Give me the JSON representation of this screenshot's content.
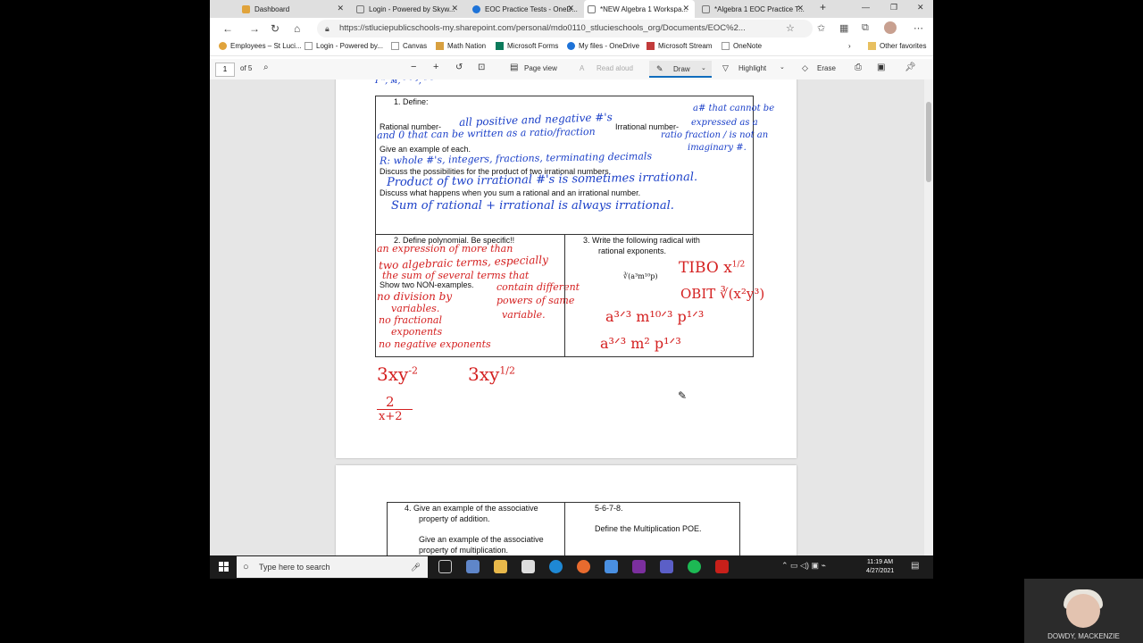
{
  "browser": {
    "tabs": [
      {
        "label": "Dashboard"
      },
      {
        "label": "Login - Powered by Skyw..."
      },
      {
        "label": "EOC Practice Tests - OneD..."
      },
      {
        "label": "*NEW Algebra 1 Workspa..."
      },
      {
        "label": "*Algebra 1 EOC Practice T..."
      }
    ],
    "url": "https://stluciepublicschools-my.sharepoint.com/personal/mdo0110_stlucieschools_org/Documents/EOC%2...",
    "favorites": [
      "Employees – St Luci...",
      "Login - Powered by...",
      "Canvas",
      "Math Nation",
      "Microsoft Forms",
      "My files - OneDrive",
      "Microsoft Stream",
      "OneNote"
    ],
    "other_favorites": "Other favorites"
  },
  "pdf_toolbar": {
    "page_number": "1",
    "page_total": "of 5",
    "page_view": "Page view",
    "read_aloud": "Read aloud",
    "draw": "Draw",
    "highlight": "Highlight",
    "erase": "Erase"
  },
  "page1": {
    "q1_title": "1.   Define:",
    "rational_label": "Rational number-",
    "irrational_label": "Irrational number-",
    "give_example": "Give an example of each.",
    "discuss_product": "Discuss the possibilities for the product of two irrational numbers.",
    "discuss_sum": "Discuss what happens when you sum a rational and an irrational number.",
    "q2_title": "2.   Define polynomial.  Be specific!!",
    "show_non": "Show two NON-examples.",
    "q3_line1": "3.   Write the following radical with",
    "q3_line2": "rational exponents.",
    "radical_expr": "∛(a³m¹⁰p)",
    "hw_rational_1": "all positive and negative #'s",
    "hw_rational_2": "and 0 that can be written as a ratio/fraction",
    "hw_irrational_1": "a# that cannot be",
    "hw_irrational_2": "expressed as a",
    "hw_irrational_3": "ratio fraction / is not an",
    "hw_irrational_4": "imaginary #.",
    "hw_example": "R: whole #'s, integers, fractions, terminating decimals",
    "hw_product": "Product of two irrational #'s is sometimes irrational.",
    "hw_sum": "Sum of rational + irrational is always irrational.",
    "hw_poly_1": "an expression of more than",
    "hw_poly_2": "two algebraic terms, especially",
    "hw_poly_3": "the sum of several terms that",
    "hw_poly_4": "contain different",
    "hw_poly_5": "powers of same",
    "hw_poly_6": "variable.",
    "hw_non_1": "no division by",
    "hw_non_2": "variables.",
    "hw_non_3": "no fractional",
    "hw_non_4": "exponents",
    "hw_non_5": "no negative exponents",
    "hw_tibo": "TIBO  x",
    "hw_tibo_exp": "1/2",
    "hw_obit": "OBIT  ∛(x²y³)",
    "hw_step1": "a³ᐟ³ m¹⁰ᐟ³ p¹ᐟ³",
    "hw_step2": "a³ᐟ³ m² p¹ᐟ³",
    "hw_ex1": "3xy",
    "hw_ex1_exp": "-2",
    "hw_ex2": "3xy",
    "hw_ex2_exp": "1/2",
    "hw_ex3_num": "2",
    "hw_ex3_den": "x+2"
  },
  "page2": {
    "q4_line1": "4.   Give an example of the associative",
    "q4_line2": "property of addition.",
    "q4_line3": "Give an example of the associative",
    "q4_line4": "property of multiplication.",
    "right_top": "5-6-7-8.",
    "right_mid": "Define the Multiplication POE."
  },
  "taskbar": {
    "search_placeholder": "Type here to search",
    "time": "11:19 AM",
    "date": "4/27/2021"
  },
  "webcam": {
    "name": "DOWDY, MACKENZIE"
  },
  "colors": {
    "ink_blue": "#1a3fc8",
    "ink_red": "#d42020",
    "accent": "#0f6cbd"
  }
}
